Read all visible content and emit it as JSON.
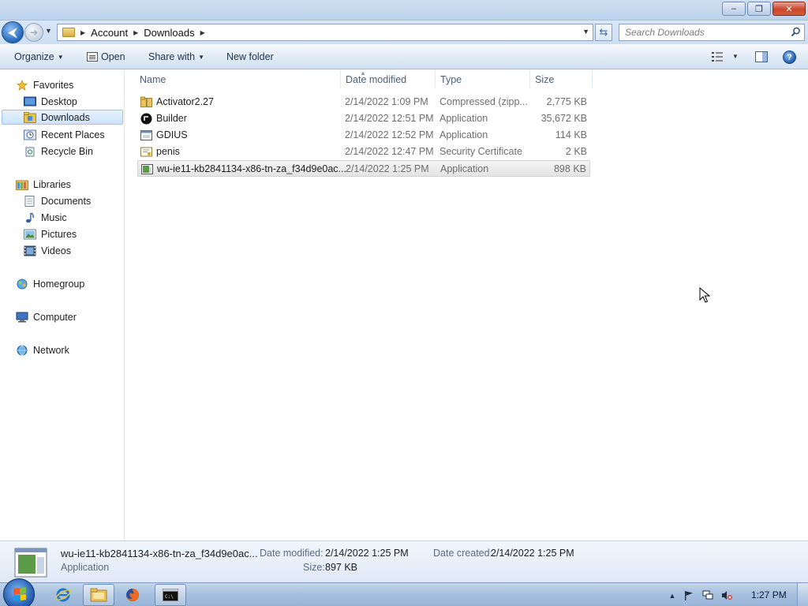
{
  "window": {
    "minimize": "–",
    "restore": "❐",
    "close": "✕"
  },
  "address": {
    "crumbs": [
      "Account",
      "Downloads"
    ],
    "search_placeholder": "Search Downloads"
  },
  "commandbar": {
    "organize": "Organize",
    "open": "Open",
    "share_with": "Share with",
    "new_folder": "New folder"
  },
  "nav": {
    "favorites": "Favorites",
    "desktop": "Desktop",
    "downloads": "Downloads",
    "recent_places": "Recent Places",
    "recycle_bin": "Recycle Bin",
    "libraries": "Libraries",
    "documents": "Documents",
    "music": "Music",
    "pictures": "Pictures",
    "videos": "Videos",
    "homegroup": "Homegroup",
    "computer": "Computer",
    "network": "Network"
  },
  "columns": {
    "name": "Name",
    "date": "Date modified",
    "type": "Type",
    "size": "Size"
  },
  "files": [
    {
      "name": "Activator2.27",
      "date": "2/14/2022 1:09 PM",
      "type": "Compressed (zipp...",
      "size": "2,775 KB",
      "icon": "zip-folder-icon"
    },
    {
      "name": "Builder",
      "date": "2/14/2022 12:51 PM",
      "type": "Application",
      "size": "35,672 KB",
      "icon": "app-dark-icon"
    },
    {
      "name": "GDIUS",
      "date": "2/14/2022 12:52 PM",
      "type": "Application",
      "size": "114 KB",
      "icon": "app-window-icon"
    },
    {
      "name": "penis",
      "date": "2/14/2022 12:47 PM",
      "type": "Security Certificate",
      "size": "2 KB",
      "icon": "certificate-icon"
    },
    {
      "name": "wu-ie11-kb2841134-x86-tn-za_f34d9e0ac...",
      "date": "2/14/2022 1:25 PM",
      "type": "Application",
      "size": "898 KB",
      "icon": "installer-icon"
    }
  ],
  "details": {
    "filename": "wu-ie11-kb2841134-x86-tn-za_f34d9e0ac...",
    "filetype": "Application",
    "modified_label": "Date modified:",
    "modified_value": "2/14/2022 1:25 PM",
    "created_label": "Date created:",
    "created_value": "2/14/2022 1:25 PM",
    "size_label": "Size:",
    "size_value": "897 KB"
  },
  "taskbar": {
    "clock": "1:27 PM"
  }
}
